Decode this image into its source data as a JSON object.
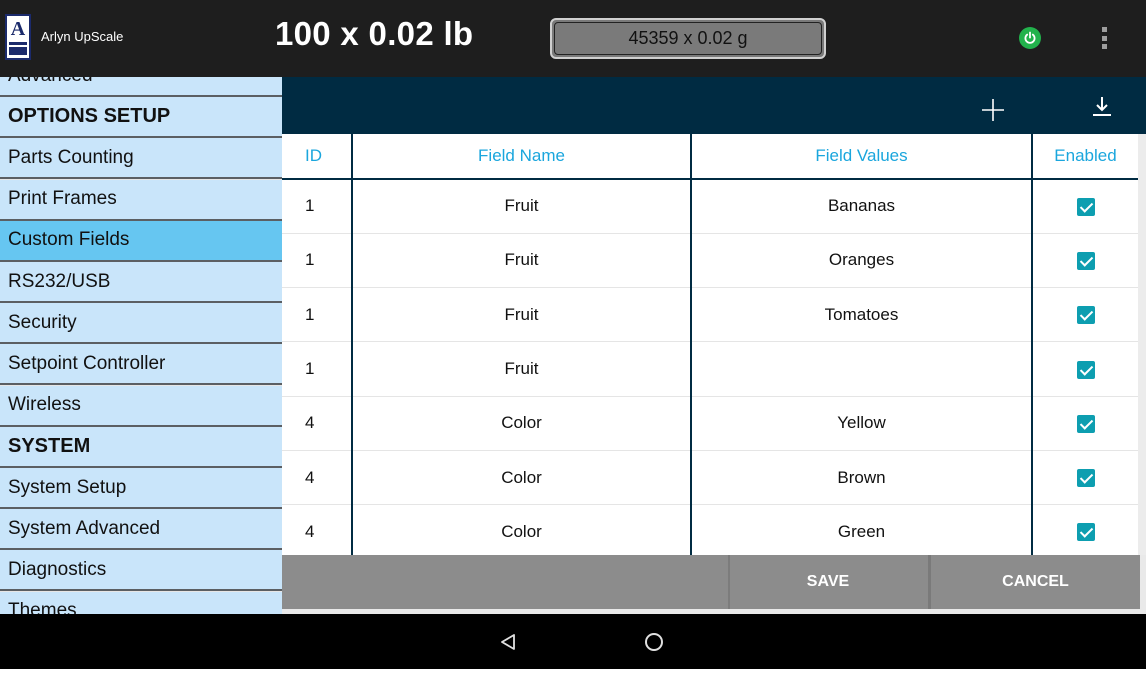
{
  "app": {
    "title": "Arlyn UpScale",
    "logo_letter": "A"
  },
  "header": {
    "weight_primary": "100 x 0.02 lb",
    "weight_secondary": "45359 x 0.02 g",
    "power_icon": "power-icon",
    "menu_icon": "more-vert-icon"
  },
  "sidebar": {
    "items": [
      {
        "label": "Advanced",
        "type": "item"
      },
      {
        "label": "OPTIONS SETUP",
        "type": "header"
      },
      {
        "label": "Parts Counting",
        "type": "item"
      },
      {
        "label": "Print Frames",
        "type": "item"
      },
      {
        "label": "Custom Fields",
        "type": "item",
        "active": true
      },
      {
        "label": "RS232/USB",
        "type": "item"
      },
      {
        "label": "Security",
        "type": "item"
      },
      {
        "label": "Setpoint Controller",
        "type": "item"
      },
      {
        "label": "Wireless",
        "type": "item"
      },
      {
        "label": "SYSTEM",
        "type": "header"
      },
      {
        "label": "System Setup",
        "type": "item"
      },
      {
        "label": "System Advanced",
        "type": "item"
      },
      {
        "label": "Diagnostics",
        "type": "item"
      },
      {
        "label": "Themes",
        "type": "item"
      }
    ]
  },
  "toolbar": {
    "add_icon": "add-icon",
    "download_icon": "download-icon"
  },
  "table": {
    "columns": [
      "ID",
      "Field Name",
      "Field Values",
      "Enabled"
    ],
    "rows": [
      {
        "id": "1",
        "name": "Fruit",
        "value": "Bananas",
        "enabled": true
      },
      {
        "id": "1",
        "name": "Fruit",
        "value": "Oranges",
        "enabled": true
      },
      {
        "id": "1",
        "name": "Fruit",
        "value": "Tomatoes",
        "enabled": true
      },
      {
        "id": "1",
        "name": "Fruit",
        "value": "",
        "enabled": true
      },
      {
        "id": "4",
        "name": "Color",
        "value": "Yellow",
        "enabled": true
      },
      {
        "id": "4",
        "name": "Color",
        "value": "Brown",
        "enabled": true
      },
      {
        "id": "4",
        "name": "Color",
        "value": "Green",
        "enabled": true
      }
    ]
  },
  "actions": {
    "save_label": "SAVE",
    "cancel_label": "CANCEL"
  },
  "navbar": {
    "back_icon": "back-icon",
    "home_icon": "home-icon"
  },
  "colors": {
    "topbar": "#1e1e1e",
    "toolbar": "#002b42",
    "sidebar_item": "#c9e5fa",
    "sidebar_active": "#66c6f1",
    "table_header_text": "#1aa6dd",
    "checkbox": "#0d9eb0",
    "power": "#22b24c"
  }
}
